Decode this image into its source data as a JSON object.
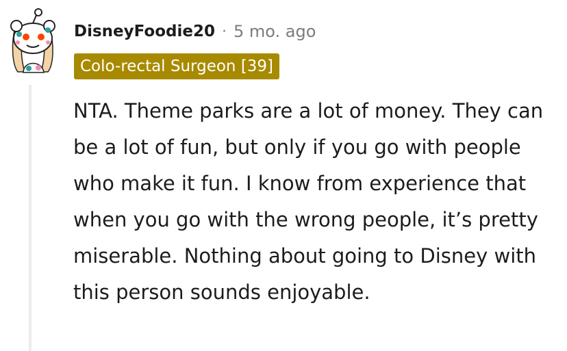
{
  "comment": {
    "username": "DisneyFoodie20",
    "separator": "·",
    "timestamp": "5 mo. ago",
    "flair": {
      "label": "Colo-rectal Surgeon [39]",
      "color": "#a88a00"
    },
    "avatar": {
      "icon": "snoo-avatar-icon"
    },
    "body": "NTA. Theme parks are a lot of money. They can be a lot of fun, but only if you go with people who make it fun. I know from experience that when you go with the wrong people, it’s pretty miserable. Nothing about going to Disney with this person sounds enjoyable."
  }
}
